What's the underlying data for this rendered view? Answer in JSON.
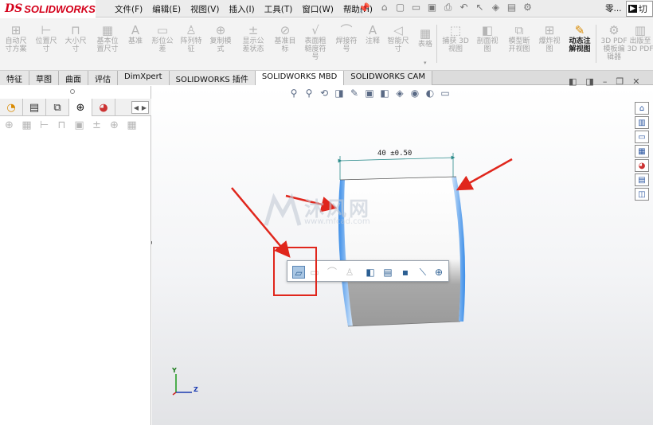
{
  "app": {
    "logo_prefix": "DS",
    "logo_text": "SOLIDWORKS"
  },
  "menu": [
    "文件(F)",
    "编辑(E)",
    "视图(V)",
    "插入(I)",
    "工具(T)",
    "窗口(W)",
    "帮助(H)"
  ],
  "quick_access_label": "零...",
  "quick_access_box": "切",
  "commands": [
    {
      "label": "自动尺\n寸方案",
      "icon": "auto-dimension-scheme-icon"
    },
    {
      "label": "位置尺\n寸",
      "icon": "location-dimension-icon"
    },
    {
      "label": "大小尺\n寸",
      "icon": "size-dimension-icon"
    },
    {
      "label": "基本位\n置尺寸",
      "icon": "basic-location-dimension-icon"
    },
    {
      "label": "基准",
      "icon": "datum-icon"
    },
    {
      "label": "形位公\n差",
      "icon": "geometric-tolerance-icon"
    },
    {
      "label": "阵列特\n征",
      "icon": "pattern-feature-icon"
    },
    {
      "label": "复制模\n式",
      "icon": "copy-scheme-icon"
    },
    {
      "label": "显示公\n差状态",
      "icon": "show-tolerance-status-icon"
    },
    {
      "label": "基准目\n标",
      "icon": "datum-target-icon"
    },
    {
      "label": "表面粗\n糙度符\n号",
      "icon": "surface-finish-icon"
    },
    {
      "label": "焊接符\n号",
      "icon": "weld-symbol-icon"
    },
    {
      "label": "注释",
      "icon": "note-icon"
    },
    {
      "label": "智能尺\n寸",
      "icon": "smart-dimension-icon"
    },
    {
      "label": "表格",
      "icon": "table-icon"
    },
    {
      "label": "捕获 3D\n视图",
      "icon": "capture-3d-view-icon"
    },
    {
      "label": "剖面视\n图",
      "icon": "section-view-icon"
    },
    {
      "label": "模型断\n开视图",
      "icon": "model-break-view-icon"
    },
    {
      "label": "爆炸视\n图",
      "icon": "exploded-view-icon"
    },
    {
      "label": "动态注\n解视图",
      "icon": "dynamic-annotation-views-icon"
    },
    {
      "label": "3D PDF\n模板编\n辑器",
      "icon": "3d-pdf-template-icon"
    },
    {
      "label": "出版至\n3D PDF",
      "icon": "publish-3d-pdf-icon"
    }
  ],
  "tabs": [
    {
      "label": "特征",
      "active": false
    },
    {
      "label": "草图",
      "active": false
    },
    {
      "label": "曲面",
      "active": false
    },
    {
      "label": "评估",
      "active": false
    },
    {
      "label": "DimXpert",
      "active": false
    },
    {
      "label": "SOLIDWORKS 插件",
      "active": false
    },
    {
      "label": "SOLIDWORKS MBD",
      "active": true
    },
    {
      "label": "SOLIDWORKS CAM",
      "active": false
    }
  ],
  "dimension_text": "40 ±0.50",
  "watermark": {
    "name": "沐风网",
    "url": "www.mfcad.com"
  },
  "triad": {
    "y": "Y",
    "z": "Z"
  },
  "colors": {
    "logo_red": "#d4001a",
    "edge_blue": "#1e90ff",
    "annotation_red": "#e0261c",
    "dimension_teal": "#2a8a8a"
  }
}
